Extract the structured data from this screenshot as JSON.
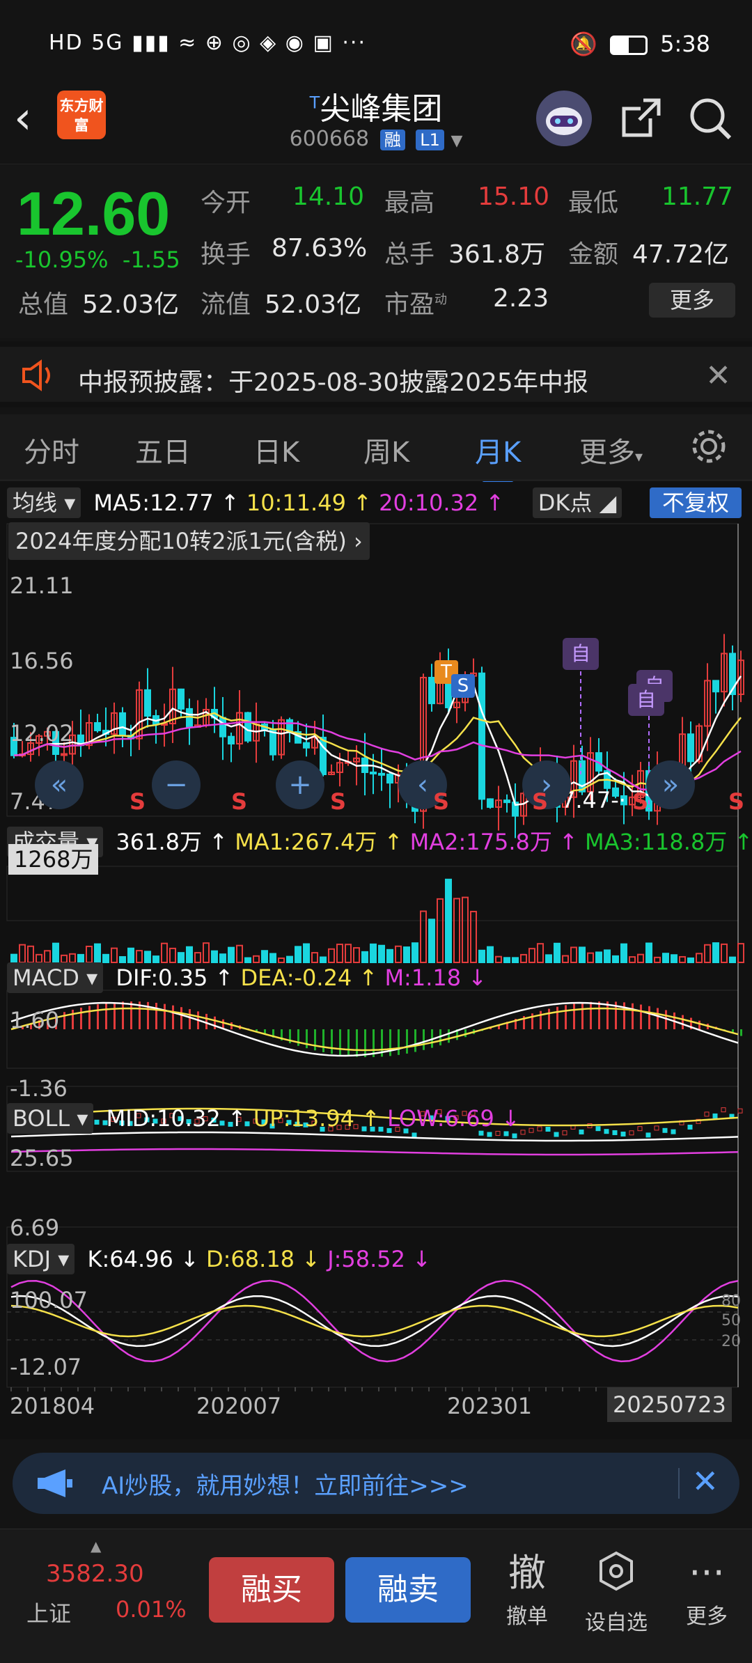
{
  "status_bar": {
    "time": "5:38",
    "left_text": "HD 5G ▮▮▮ ≈ ⊕ ◎ ◈ ◉ ▣ ···"
  },
  "header": {
    "logo_text": "东方财富",
    "title_prefix": "T",
    "title": "尖峰集团",
    "code": "600668",
    "tag_rong": "融",
    "tag_level": "L1"
  },
  "quote": {
    "price": "12.60",
    "change_pct": "-10.95%",
    "change_abs": "-1.55",
    "jin_kai_label": "今开",
    "jin_kai": "14.10",
    "zui_gao_label": "最高",
    "zui_gao": "15.10",
    "zui_di_label": "最低",
    "zui_di": "11.77",
    "huan_shou_label": "换手",
    "huan_shou": "87.63%",
    "zong_shou_label": "总手",
    "zong_shou": "361.8万",
    "jin_e_label": "金额",
    "jin_e": "47.72亿",
    "zong_zhi_label": "总值",
    "zong_zhi": "52.03亿",
    "liu_zhi_label": "流值",
    "liu_zhi": "52.03亿",
    "shi_ying_label": "市盈",
    "shi_ying_sup": "动",
    "shi_ying": "2.23",
    "more_label": "更多"
  },
  "notice": {
    "text": "中报预披露：于2025-08-30披露2025年中报"
  },
  "tabs": [
    "分时",
    "五日",
    "日K",
    "周K",
    "月K",
    "更多"
  ],
  "chart": {
    "ma_btn": "均线",
    "ma5": "MA5:12.77 ↑",
    "ma10": "10:11.49 ↑",
    "ma20": "20:10.32 ↑",
    "dk_btn": "DK点",
    "fq_btn": "不复权",
    "note": "2024年度分配10转2派1元(含税)",
    "y_labels": [
      "21.11",
      "16.56",
      "12.02",
      "7.47"
    ],
    "low_label": "7.47",
    "markers": {
      "T": "T",
      "S": "S",
      "zi": "自"
    },
    "vol_btn": "成交量",
    "vol_val": "361.8万 ↑",
    "vol_ma1": "MA1:267.4万 ↑",
    "vol_ma2": "MA2:175.8万 ↑",
    "vol_ma3": "MA3:118.8万 ↑",
    "vol_max": "1268万",
    "macd_btn": "MACD",
    "dif": "DIF:0.35 ↑",
    "dea": "DEA:-0.24 ↑",
    "m": "M:1.18 ↓",
    "macd_top": "1.60",
    "macd_bot": "-1.36",
    "boll_btn": "BOLL",
    "mid": "MID:10.32 ↑",
    "up": "UP:13.94 ↑",
    "low": "LOW:6.69 ↓",
    "boll_top": "25.65",
    "boll_bot": "6.69",
    "kdj_btn": "KDJ",
    "k": "K:64.96 ↓",
    "d": "D:68.18 ↓",
    "j": "J:58.52 ↓",
    "kdj_top": "100.07",
    "kdj_bot": "-12.07",
    "kdj_80": "80",
    "kdj_50": "50",
    "kdj_20": "20",
    "x_labels": [
      "201804",
      "202007",
      "202301"
    ],
    "x_current": "20250723"
  },
  "ai_bar": {
    "text": "AI炒股，就用妙想！立即前往>>>"
  },
  "bottom": {
    "index_value": "3582.30",
    "index_name": "上证",
    "index_pct": "0.01%",
    "buy": "融买",
    "sell": "融卖",
    "cancel": "撤单",
    "cancel_glyph": "撤",
    "watch": "设自选",
    "more": "更多"
  },
  "colors": {
    "up": "#e43c3c",
    "down": "#19c52e",
    "ma5": "#ffffff",
    "ma10": "#f5e14a",
    "ma20": "#e23fe0",
    "accent": "#3a86f5"
  }
}
